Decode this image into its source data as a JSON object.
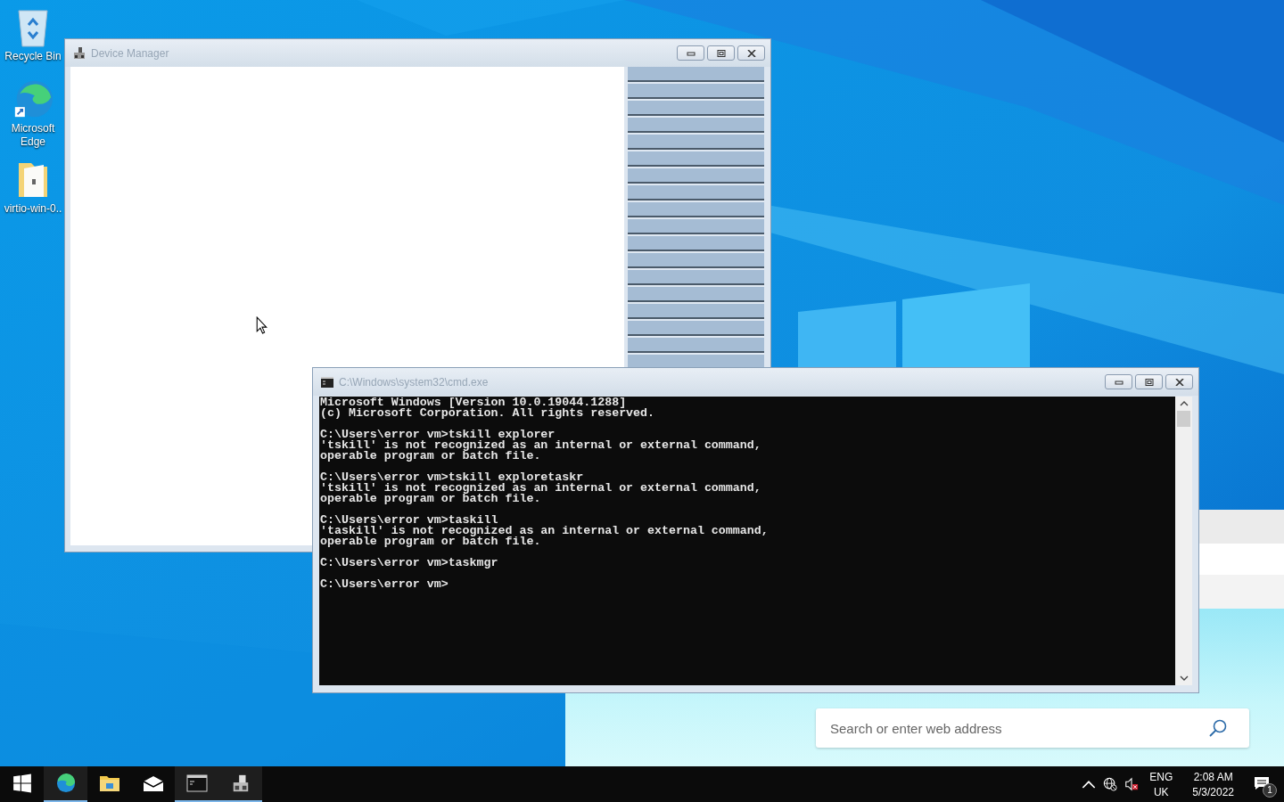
{
  "desktop_icons": [
    {
      "kind": "recycle",
      "label": "Recycle Bin"
    },
    {
      "kind": "edge",
      "label": "Microsoft Edge"
    },
    {
      "kind": "folder",
      "label": "virtio-win-0.."
    }
  ],
  "device_manager": {
    "title": "Device Manager"
  },
  "browser": {
    "search": {
      "placeholder": "Search or enter web address"
    }
  },
  "cmd": {
    "title": "C:\\Windows\\system32\\cmd.exe",
    "blocks": [
      [
        "Microsoft Windows [Version 10.0.19044.1288]",
        "(c) Microsoft Corporation. All rights reserved."
      ],
      [
        "C:\\Users\\error vm>tskill explorer",
        "'tskill' is not recognized as an internal or external command,",
        "operable program or batch file."
      ],
      [
        "C:\\Users\\error vm>tskill exploretaskr",
        "'tskill' is not recognized as an internal or external command,",
        "operable program or batch file."
      ],
      [
        "C:\\Users\\error vm>taskill",
        "'taskill' is not recognized as an internal or external command,",
        "operable program or batch file."
      ],
      [
        "C:\\Users\\error vm>taskmgr"
      ],
      [
        "C:\\Users\\error vm>"
      ]
    ]
  },
  "taskbar": {
    "apps": [
      {
        "kind": "start",
        "active": false
      },
      {
        "kind": "edge",
        "active": true
      },
      {
        "kind": "explorer",
        "active": false
      },
      {
        "kind": "mail",
        "active": false
      },
      {
        "kind": "cmd",
        "active": true
      },
      {
        "kind": "devmgr",
        "active": true
      }
    ],
    "language": "ENG",
    "region": "UK",
    "time": "2:08 AM",
    "date": "5/3/2022",
    "notifications": "1"
  }
}
